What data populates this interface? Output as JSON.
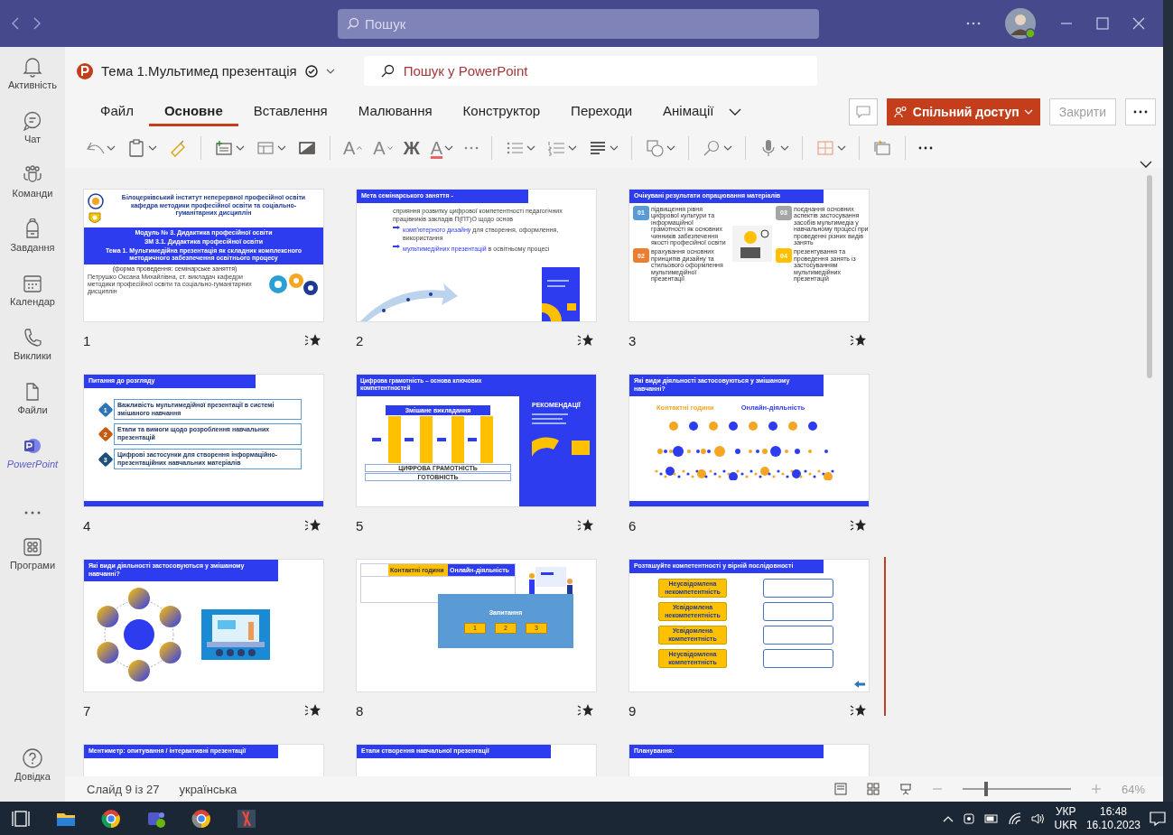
{
  "titlebar": {
    "search_placeholder": "Пошук"
  },
  "rail": {
    "items": [
      {
        "label": "Активність",
        "selected": false
      },
      {
        "label": "Чат",
        "selected": false
      },
      {
        "label": "Команди",
        "selected": false
      },
      {
        "label": "Завдання",
        "selected": false
      },
      {
        "label": "Календар",
        "selected": false
      },
      {
        "label": "Виклики",
        "selected": false
      },
      {
        "label": "Файли",
        "selected": false
      },
      {
        "label": "PowerPoint",
        "selected": true
      }
    ],
    "apps": {
      "label": "Програми"
    },
    "help": {
      "label": "Довідка"
    }
  },
  "document": {
    "title": "Тема 1.Мультимед презентація",
    "search_placeholder": "Пошук у PowerPoint"
  },
  "ribbon": {
    "tabs": [
      {
        "label": "Файл",
        "selected": false
      },
      {
        "label": "Основне",
        "selected": true
      },
      {
        "label": "Вставлення",
        "selected": false
      },
      {
        "label": "Малювання",
        "selected": false
      },
      {
        "label": "Конструктор",
        "selected": false
      },
      {
        "label": "Переходи",
        "selected": false
      },
      {
        "label": "Анімації",
        "selected": false
      }
    ],
    "share": "Спільний доступ",
    "close": "Закрити"
  },
  "toolbar": {
    "grow_font": "A",
    "shrink_font": "A",
    "bold": "Ж",
    "font_color": "A"
  },
  "slides": [
    {
      "kind": "cover",
      "number": "1",
      "selected": false,
      "institute": "Білоцерківський інститут неперервної професійної освіти",
      "department": "кафедра методики професійної освіти та соціально-гуманітарних дисциплін",
      "band": [
        "Модуль № 3. Дидактика професійної освіти",
        "ЗМ 3.1. Дидактика професійної освіти",
        "Тема 1. Мультимедійна презентація як складник комплексного методичного забезпечення освітнього процесу"
      ],
      "form": "(форма проведення: семінарське заняття)",
      "author": "Петрушко Оксана Михайлівна, ст. викладач кафедри методики професійної освіти та соціально-гуманітарних дисциплін"
    },
    {
      "kind": "goal",
      "number": "2",
      "selected": false,
      "title": "Мета семінарського заняття -",
      "intro": "сприяння розвитку цифрової компетентності педагогічних працівників закладів П(ПТ)О щодо основ",
      "points": [
        {
          "highlight": "комп'ютерного дизайну",
          "text": "для створення, оформлення, використання"
        },
        {
          "highlight": "мультимедійних презентацій",
          "text": "в освітньому процесі"
        }
      ]
    },
    {
      "kind": "outcomes",
      "number": "3",
      "selected": false,
      "title": "Очікувані результати опрацювання матеріалів",
      "items": [
        {
          "number": "01",
          "color": "#5b9bd5",
          "text": "підвищення рівня цифрової культури та інформаційної грамотності як основних чинників забезпечення якості професійної освіти"
        },
        {
          "number": "02",
          "color": "#ed7d31",
          "text": "врахування основних принципів дизайну та стильового оформлення мультимедійної презентації"
        },
        {
          "number": "03",
          "color": "#a5a5a5",
          "text": "поєднання основних аспектів застосування засобів мультимедіа у навчальному процесі при проведенні різних видів занять"
        },
        {
          "number": "04",
          "color": "#ffc000",
          "text": "презентування та проведення занять із застосуванням мультимедійних презентацій"
        }
      ]
    },
    {
      "kind": "questions",
      "number": "4",
      "selected": false,
      "title": "Питання до розгляду",
      "items": [
        {
          "number": "1",
          "color": "#2e75b6",
          "text": "Важливість мультимедійної презентації в системі змішаного навчання"
        },
        {
          "number": "2",
          "color": "#c55a11",
          "text": "Етапи та вимоги щодо розроблення навчальних презентацій"
        },
        {
          "number": "3",
          "color": "#1f4e79",
          "text": "Цифрові застосунки для створення інформаційно-презентаційних навчальних матеріалів"
        }
      ]
    },
    {
      "kind": "pillars",
      "number": "5",
      "selected": false,
      "title": "Цифрова грамотність – основа ключових компетентностей",
      "roof": "Змішане викладання",
      "base": "ЦИФРОВА ГРАМОТНІСТЬ",
      "foundation": "ГОТОВНІСТЬ",
      "panel_title": "РЕКОМЕНДАЦІЇ"
    },
    {
      "kind": "dots",
      "number": "6",
      "selected": false,
      "title": "Які види діяльності застосовуються у змішаному навчанні?",
      "legend": [
        {
          "label": "Контактні години",
          "color": "#f5a623"
        },
        {
          "label": "Онлайн-діяльність",
          "color": "#2e3cf0"
        }
      ]
    },
    {
      "kind": "cycle",
      "number": "7",
      "selected": false,
      "title": "Які види діяльності застосовуються у змішаному навчанні?"
    },
    {
      "kind": "quiz",
      "number": "8",
      "selected": false,
      "columns": [
        "Контактні години",
        "Онлайн-діяльність"
      ],
      "question": "Запитання",
      "answers": [
        "1",
        "2",
        "3"
      ]
    },
    {
      "kind": "order",
      "number": "9",
      "selected": true,
      "title": "Розташуйте компетентності у вірній послідовності",
      "cards": [
        "Неусвідомлена некомпетентність",
        "Усвідомлена некомпетентність",
        "Усвідомлена компетентність",
        "Неусвідомлена компетентність"
      ]
    },
    {
      "kind": "partial",
      "selected": false,
      "title": "Ментиметр: опитування / інтерактивні презентації"
    },
    {
      "kind": "partial",
      "selected": false,
      "title": "Етапи створення навчальної презентації"
    },
    {
      "kind": "partial",
      "selected": false,
      "title": "Планування:"
    }
  ],
  "status_bar": {
    "slide_info": "Слайд 9 із 27",
    "language": "українська",
    "zoom": "64%",
    "zoom_slider": {
      "level": 0.2
    }
  },
  "taskbar": {
    "lang_top": "УКР",
    "lang_bottom": "UKR",
    "time": "16:48",
    "date": "16.10.2023"
  }
}
